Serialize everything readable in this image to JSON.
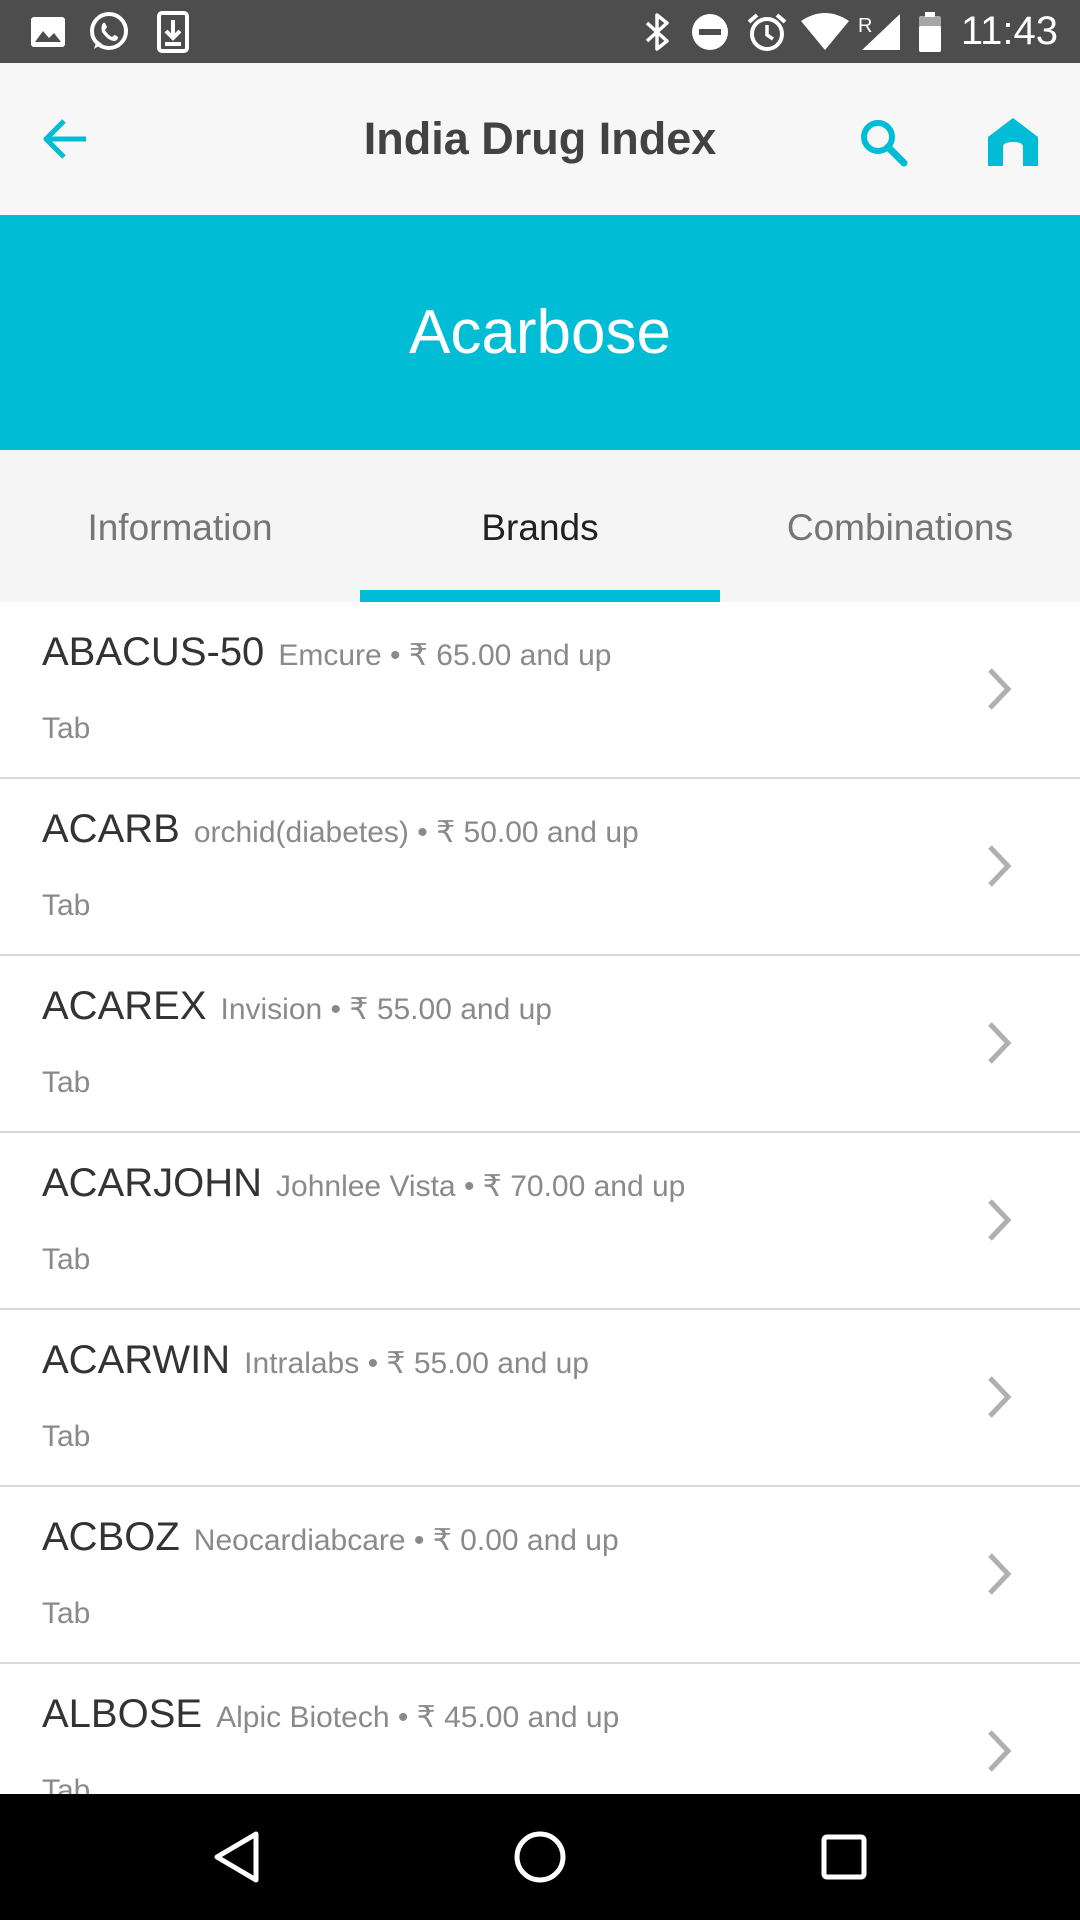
{
  "status_bar": {
    "time": "11:43",
    "icons": [
      "image-icon",
      "whatsapp-icon",
      "download-icon",
      "bluetooth-icon",
      "do-not-disturb-icon",
      "alarm-icon",
      "wifi-icon",
      "signal-icon",
      "battery-icon"
    ],
    "roaming_label": "R"
  },
  "app_bar": {
    "title": "India Drug Index",
    "back_icon": "arrow-left-icon",
    "search_icon": "search-icon",
    "home_icon": "home-icon"
  },
  "banner": {
    "drug_name": "Acarbose"
  },
  "tabs": [
    {
      "label": "Information",
      "active": false
    },
    {
      "label": "Brands",
      "active": true
    },
    {
      "label": "Combinations",
      "active": false
    }
  ],
  "brands": [
    {
      "name": "ABACUS-50",
      "meta": "Emcure • ₹ 65.00 and up",
      "form": "Tab"
    },
    {
      "name": "ACARB",
      "meta": "orchid(diabetes) • ₹ 50.00 and up",
      "form": "Tab"
    },
    {
      "name": "ACAREX",
      "meta": "Invision • ₹ 55.00 and up",
      "form": "Tab"
    },
    {
      "name": "ACARJOHN",
      "meta": "Johnlee Vista • ₹ 70.00 and up",
      "form": "Tab"
    },
    {
      "name": "ACARWIN",
      "meta": "Intralabs • ₹ 55.00 and up",
      "form": "Tab"
    },
    {
      "name": "ACBOZ",
      "meta": "Neocardiabcare • ₹ 0.00 and up",
      "form": "Tab"
    },
    {
      "name": "ALBOSE",
      "meta": "Alpic Biotech • ₹ 45.00 and up",
      "form": "Tab"
    }
  ],
  "nav_bar": {
    "icons": [
      "back-triangle-icon",
      "home-circle-icon",
      "recents-square-icon"
    ]
  },
  "colors": {
    "accent": "#00bcd4",
    "status_bar": "#4d4d4d",
    "app_bar": "#f7f7f7",
    "title_text": "#424242",
    "secondary_text": "#8a8a8a"
  }
}
